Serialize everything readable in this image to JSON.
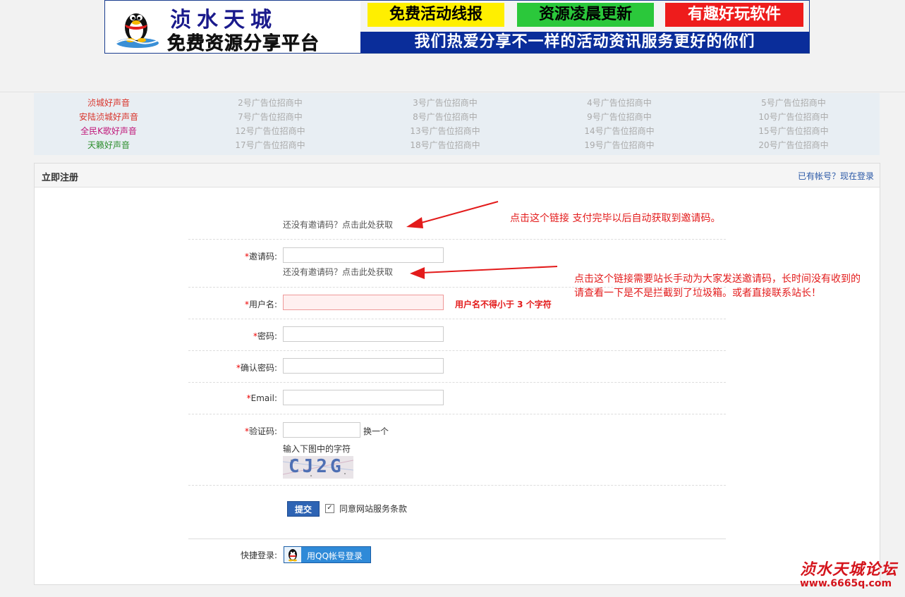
{
  "banner": {
    "logo_title": "浈水天城",
    "logo_subtitle": "免费资源分享平台",
    "tags": [
      "免费活动线报",
      "资源凌晨更新",
      "有趣好玩软件"
    ],
    "slogan": "我们热爱分享不一样的活动资讯服务更好的你们"
  },
  "ads": {
    "rows": [
      [
        "浈城好声音",
        "2号广告位招商中",
        "3号广告位招商中",
        "4号广告位招商中",
        "5号广告位招商中"
      ],
      [
        "安陆浈城好声音",
        "7号广告位招商中",
        "8号广告位招商中",
        "9号广告位招商中",
        "10号广告位招商中"
      ],
      [
        "全民K歌好声音",
        "12号广告位招商中",
        "13号广告位招商中",
        "14号广告位招商中",
        "15号广告位招商中"
      ],
      [
        "天籁好声音",
        "17号广告位招商中",
        "18号广告位招商中",
        "19号广告位招商中",
        "20号广告位招商中"
      ]
    ],
    "first_col_colors": [
      "#d9342b",
      "#d9342b",
      "#c0187a",
      "#2f8f2f"
    ]
  },
  "register": {
    "title": "立即注册",
    "login_link": "已有帐号？现在登录",
    "invite_link_top": "还没有邀请码？点击此处获取",
    "invite_label": "邀请码:",
    "invite_link_below": "还没有邀请码？点击此处获取",
    "username_label": "用户名:",
    "username_error": "用户名不得小于 3 个字符",
    "password_label": "密码:",
    "confirm_label": "确认密码:",
    "email_label": "Email:",
    "captcha_label": "验证码:",
    "captcha_swap": "换一个",
    "captcha_tip": "输入下图中的字符",
    "captcha_text": "CJ2G",
    "submit_label": "提交",
    "agree_label": "同意网站服务条款",
    "agree_checked": true,
    "quick_login_label": "快捷登录:",
    "qq_login_label": "用QQ帐号登录",
    "required_mark": "*"
  },
  "annotations": {
    "note1": "点击这个链接 支付完毕以后自动获取到邀请码。",
    "note2_line1": "点击这个链接需要站长手动为大家发送邀请码，长时间没有收到的",
    "note2_line2": "请查看一下是不是拦截到了垃圾箱。或者直接联系站长！",
    "color": "#e31b1b"
  },
  "watermark": {
    "title": "浈水天城论坛",
    "url": "www.6665q.com"
  }
}
